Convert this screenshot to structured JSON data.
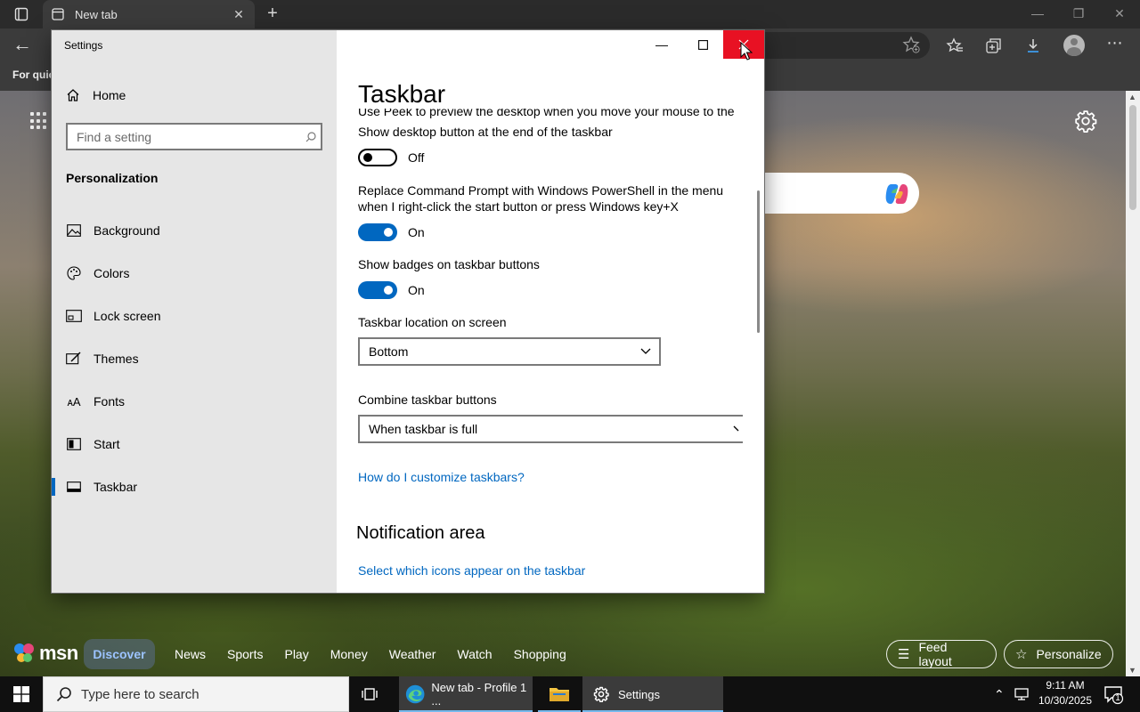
{
  "browser": {
    "tab_title": "New tab",
    "tab_close": "✕",
    "new_tab": "+",
    "favorites_text": "For quic"
  },
  "msn": {
    "logo_text": "msn",
    "nav": [
      "Discover",
      "News",
      "Sports",
      "Play",
      "Money",
      "Weather",
      "Watch",
      "Shopping"
    ],
    "feed_layout": "Feed layout",
    "personalize": "Personalize"
  },
  "taskbar": {
    "search_placeholder": "Type here to search",
    "edge_app": "New tab - Profile 1 ...",
    "settings_app": "Settings",
    "time": "9:11 AM",
    "date": "10/30/2025",
    "notification_count": "1"
  },
  "settings": {
    "window_title": "Settings",
    "home": "Home",
    "find_placeholder": "Find a setting",
    "section": "Personalization",
    "nav_items": [
      {
        "label": "Background",
        "icon": "picture-icon"
      },
      {
        "label": "Colors",
        "icon": "palette-icon"
      },
      {
        "label": "Lock screen",
        "icon": "lock-screen-icon"
      },
      {
        "label": "Themes",
        "icon": "themes-icon"
      },
      {
        "label": "Fonts",
        "icon": "fonts-icon"
      },
      {
        "label": "Start",
        "icon": "start-icon"
      },
      {
        "label": "Taskbar",
        "icon": "taskbar-icon"
      }
    ],
    "page_title": "Taskbar",
    "cut_text": "Use Peek to preview the desktop when you move your mouse to the",
    "options": [
      {
        "label": "Show desktop button at the end of the taskbar",
        "state": "Off"
      },
      {
        "label": "Replace Command Prompt with Windows PowerShell in the menu when I right-click the start button or press Windows key+X",
        "state": "On"
      },
      {
        "label": "Show badges on taskbar buttons",
        "state": "On"
      }
    ],
    "location_label": "Taskbar location on screen",
    "location_value": "Bottom",
    "combine_label": "Combine taskbar buttons",
    "combine_value": "When taskbar is full",
    "help_link": "How do I customize taskbars?",
    "notification_header": "Notification area",
    "icons_link": "Select which icons appear on the taskbar"
  },
  "colors": {
    "accent": "#0067c0",
    "close_red": "#e81123"
  }
}
